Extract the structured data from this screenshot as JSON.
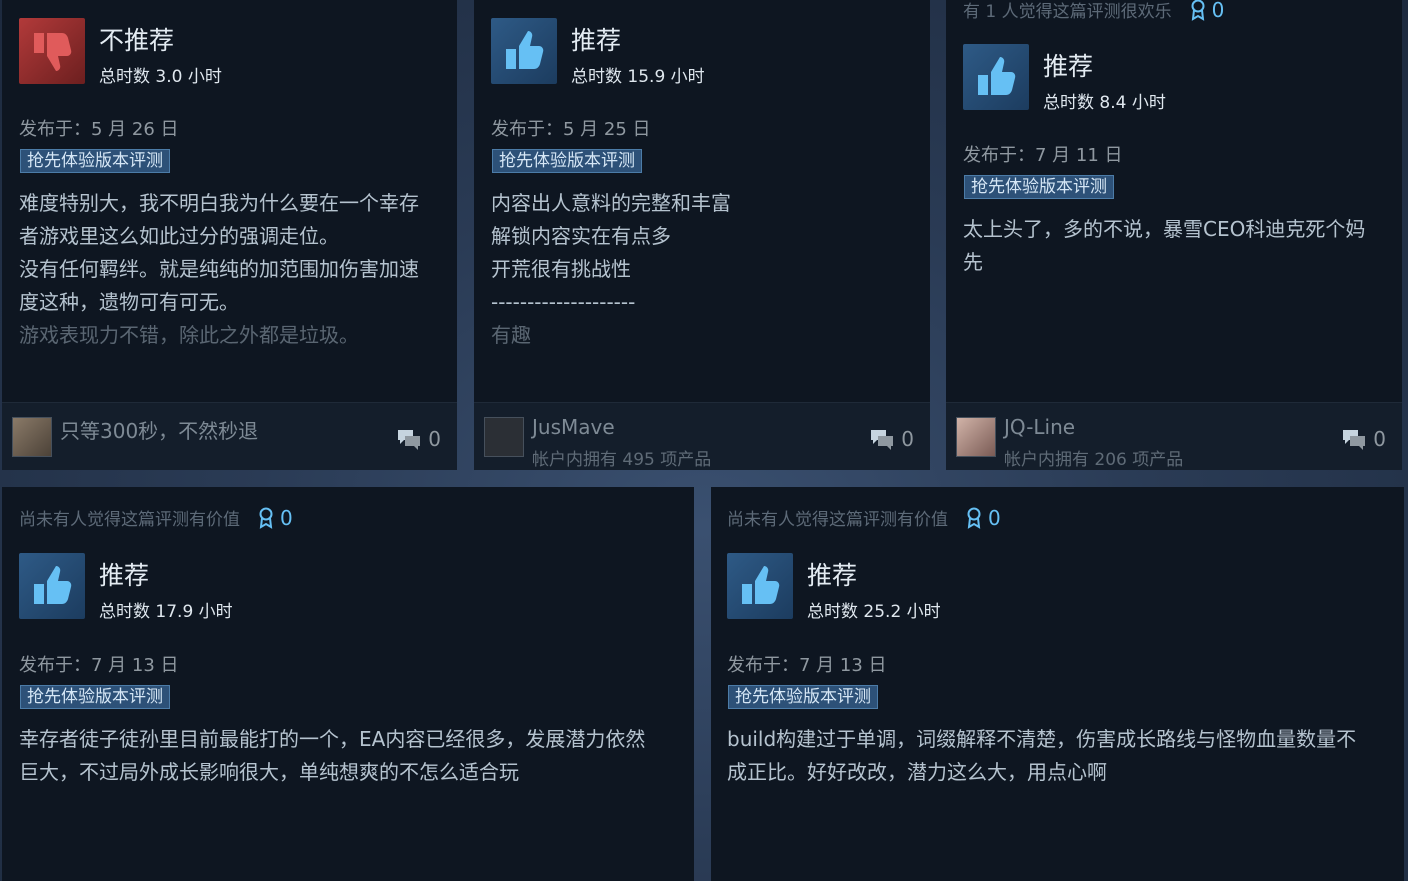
{
  "colors": {
    "card_bg": "#0e1621",
    "page_bg": "#2a3b55",
    "accent_blue": "#66c0f4",
    "badge_bg": "#2d5178",
    "thumb_up_bg": "#2e5a86",
    "thumb_down_bg": "#b23a3a"
  },
  "reviews": [
    {
      "helpful_text": "",
      "award_count": "",
      "verdict": "不推荐",
      "verdict_icon": "thumbs-down-icon",
      "hours": "总时数 3.0 小时",
      "posted": "发布于：5 月 26 日",
      "badge": "抢先体验版本评测",
      "lines": [
        "难度特别大，我不明白我为什么要在一个幸存",
        "者游戏里这么如此过分的强调走位。",
        "没有任何羁绊。就是纯纯的加范围加伤害加速",
        "度这种，遗物可有可无。"
      ],
      "faded_line": "游戏表现力不错，除此之外都是垃圾。",
      "author": "只等300秒，不然秒退",
      "owned": "",
      "comments": "0"
    },
    {
      "helpful_text": "",
      "award_count": "",
      "verdict": "推荐",
      "verdict_icon": "thumbs-up-icon",
      "hours": "总时数 15.9 小时",
      "posted": "发布于：5 月 25 日",
      "badge": "抢先体验版本评测",
      "lines": [
        "内容出人意料的完整和丰富",
        "解锁内容实在有点多",
        "开荒很有挑战性",
        "--------------------"
      ],
      "faded_line": "有趣",
      "author": "JusMave",
      "owned": "帐户内拥有 495 项产品",
      "comments": "0"
    },
    {
      "helpful_text": "有 1 人觉得这篇评测很欢乐",
      "award_count": "0",
      "verdict": "推荐",
      "verdict_icon": "thumbs-up-icon",
      "hours": "总时数 8.4 小时",
      "posted": "发布于：7 月 11 日",
      "badge": "抢先体验版本评测",
      "lines": [
        "太上头了，多的不说，暴雪CEO科迪克死个妈",
        "先"
      ],
      "faded_line": "",
      "author": "JQ-Line",
      "owned": "帐户内拥有 206 项产品",
      "comments": "0"
    },
    {
      "helpful_text": "尚未有人觉得这篇评测有价值",
      "award_count": "0",
      "verdict": "推荐",
      "verdict_icon": "thumbs-up-icon",
      "hours": "总时数 17.9 小时",
      "posted": "发布于：7 月 13 日",
      "badge": "抢先体验版本评测",
      "lines": [
        "幸存者徒子徒孙里目前最能打的一个，EA内容已经很多，发展潜力依然",
        "巨大，不过局外成长影响很大，单纯想爽的不怎么适合玩"
      ],
      "faded_line": "",
      "author": "",
      "owned": "",
      "comments": ""
    },
    {
      "helpful_text": "尚未有人觉得这篇评测有价值",
      "award_count": "0",
      "verdict": "推荐",
      "verdict_icon": "thumbs-up-icon",
      "hours": "总时数 25.2 小时",
      "posted": "发布于：7 月 13 日",
      "badge": "抢先体验版本评测",
      "lines": [
        "build构建过于单调，词缀解释不清楚，伤害成长路线与怪物血量数量不",
        "成正比。好好改改，潜力这么大，用点心啊"
      ],
      "faded_line": "",
      "author": "",
      "owned": "",
      "comments": ""
    }
  ]
}
